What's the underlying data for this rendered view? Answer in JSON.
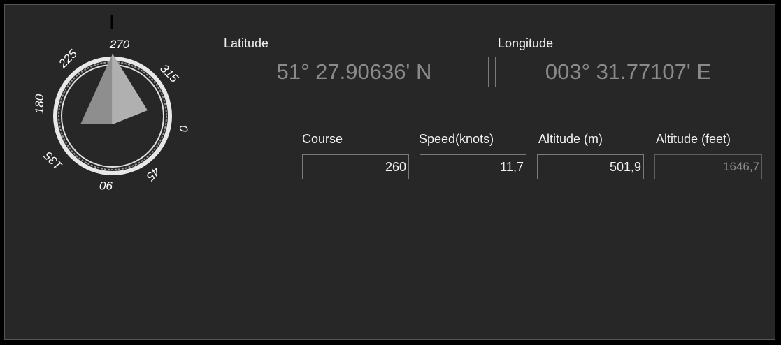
{
  "compass": {
    "labels": [
      "270",
      "315",
      "0",
      "45",
      "90",
      "135",
      "180",
      "225"
    ],
    "course": 260
  },
  "latitude": {
    "label": "Latitude",
    "value": "51° 27.90636' N"
  },
  "longitude": {
    "label": "Longitude",
    "value": "003° 31.77107' E"
  },
  "course": {
    "label": "Course",
    "value": "260"
  },
  "speed": {
    "label": "Speed(knots)",
    "value": "11,7"
  },
  "altitude_m": {
    "label": "Altitude (m)",
    "value": "501,9"
  },
  "altitude_ft": {
    "label": "Altitude (feet)",
    "value": "1646,7"
  }
}
